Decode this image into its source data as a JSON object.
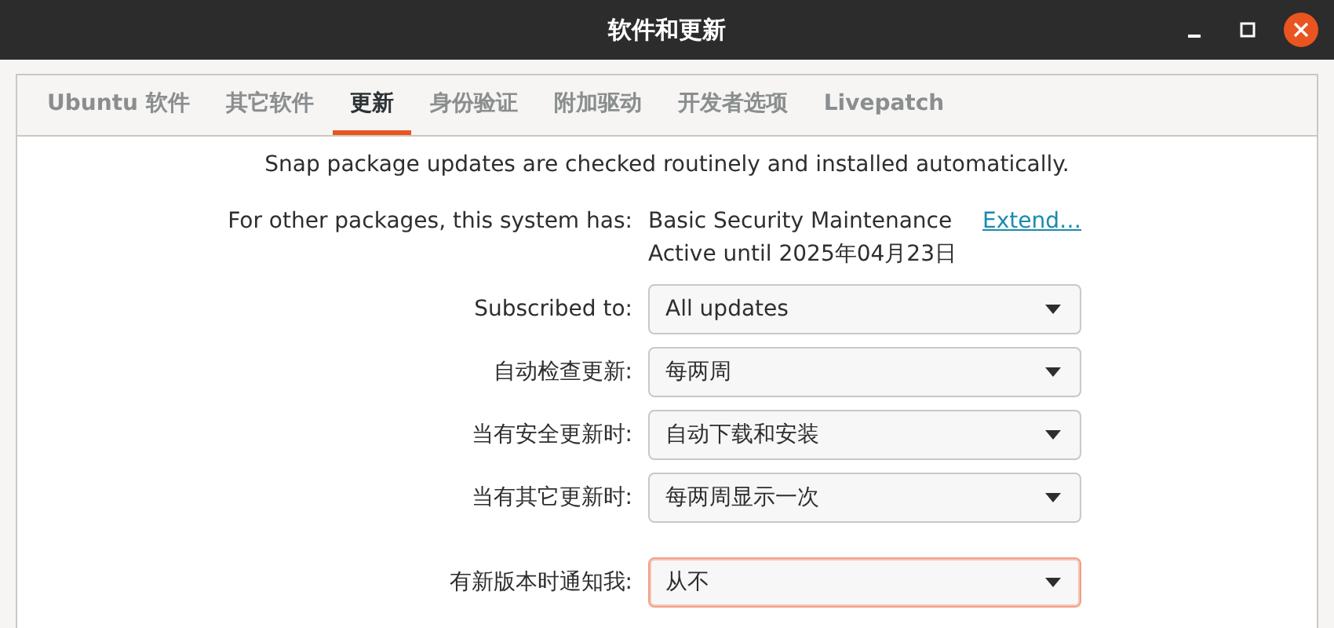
{
  "window": {
    "title": "软件和更新"
  },
  "tabs": [
    {
      "label": "Ubuntu 软件",
      "selected": false
    },
    {
      "label": "其它软件",
      "selected": false
    },
    {
      "label": "更新",
      "selected": true
    },
    {
      "label": "身份验证",
      "selected": false
    },
    {
      "label": "附加驱动",
      "selected": false
    },
    {
      "label": "开发者选项",
      "selected": false
    },
    {
      "label": "Livepatch",
      "selected": false
    }
  ],
  "snap_note": "Snap package updates are checked routinely and installed automatically.",
  "maintenance": {
    "label": "For other packages, this system has:",
    "value": "Basic Security Maintenance",
    "link": "Extend…",
    "active_until": "Active until 2025年04月23日"
  },
  "settings": [
    {
      "label": "Subscribed to:",
      "value": "All updates",
      "focused": false
    },
    {
      "label": "自动检查更新:",
      "value": "每两周",
      "focused": false
    },
    {
      "label": "当有安全更新时:",
      "value": "自动下载和安装",
      "focused": false
    },
    {
      "label": "当有其它更新时:",
      "value": "每两周显示一次",
      "focused": false
    },
    {
      "label": "有新版本时通知我:",
      "value": "从不",
      "focused": true
    }
  ]
}
